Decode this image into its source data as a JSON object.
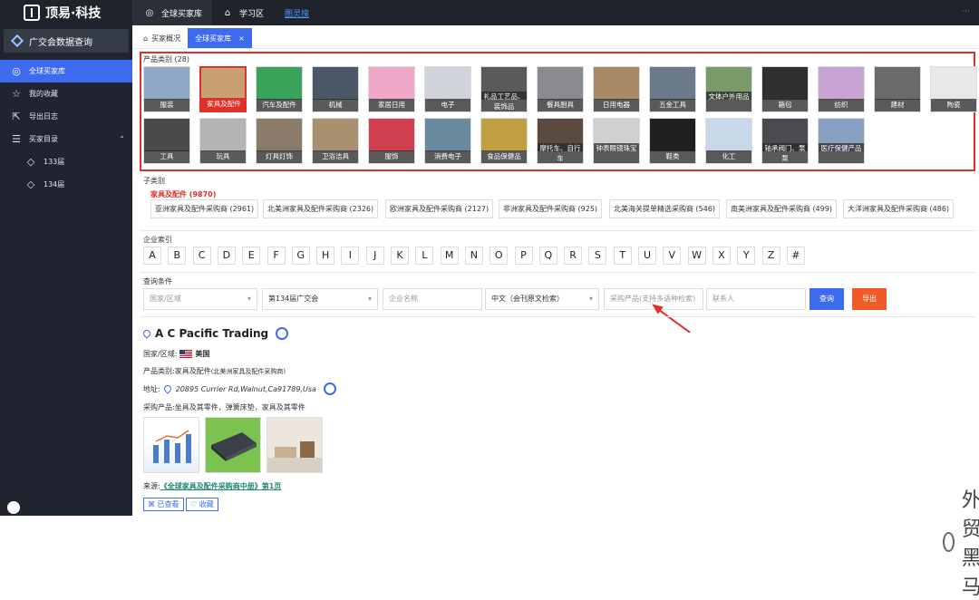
{
  "brand": {
    "name": "顶易·科技"
  },
  "top_tabs": [
    {
      "label": "全球买家库",
      "icon": "globe-icon"
    },
    {
      "label": "学习区",
      "icon": "hat-icon"
    },
    {
      "label": "图灵搜",
      "icon": ""
    }
  ],
  "sidebar": {
    "search_btn": "广交会数据查询",
    "items": [
      {
        "label": "全球买家库",
        "icon": "globe-icon"
      },
      {
        "label": "我的收藏",
        "icon": "star-icon"
      },
      {
        "label": "导出日志",
        "icon": "export-icon"
      },
      {
        "label": "买家目录",
        "icon": "list-icon"
      },
      {
        "label": "133届",
        "icon": "tag-icon"
      },
      {
        "label": "134届",
        "icon": "tag-icon"
      }
    ]
  },
  "page_tabs": [
    {
      "label": "买家概况"
    },
    {
      "label": "全球买家库"
    }
  ],
  "product": {
    "title": "产品类别 (28)",
    "items": [
      "服装",
      "家具及配件",
      "汽车及配件",
      "机械",
      "家居日用",
      "电子",
      "礼品工艺品、装饰品",
      "餐具厨具",
      "日用电器",
      "五金工具",
      "文体户外用品",
      "箱包",
      "纺织",
      "建材",
      "陶瓷",
      "工具",
      "玩具",
      "灯具灯饰",
      "卫浴洁具",
      "服饰",
      "消费电子",
      "食品保健品",
      "摩托车、自行车",
      "钟表眼镜珠宝",
      "鞋类",
      "化工",
      "轴承阀门、泵泵",
      "医疗保健产品"
    ],
    "colors": [
      "#8fa7c4",
      "#c8a074",
      "#3aa35a",
      "#4a5868",
      "#f0a8c8",
      "#d0d4da",
      "#5a5a5a",
      "#8a8a90",
      "#a88a66",
      "#6a7a8a",
      "#7a9a6a",
      "#303030",
      "#c8a4d4",
      "#6a6a6a",
      "#e8e8e8",
      "#4a4a4a",
      "#b4b4b4",
      "#8a7a6a",
      "#a89070",
      "#d04050",
      "#6a8aa0",
      "#c0a040",
      "#5a4a40",
      "#d0d0d0",
      "#202020",
      "#c8d8e8",
      "#4a4a50",
      "#8aa0c0"
    ]
  },
  "subcat": {
    "title": "子类别",
    "selected": "家具及配件 (9870)",
    "chips": [
      "亚洲家具及配件采购商 (2961)",
      "北美洲家具及配件采购商 (2326)",
      "欧洲家具及配件采购商 (2127)",
      "非洲家具及配件采购商 (925)",
      "北美海关提单精选采购商 (546)",
      "南美洲家具及配件采购商 (499)",
      "大洋洲家具及配件采购商 (486)"
    ]
  },
  "index": {
    "title": "企业索引",
    "letters": [
      "A",
      "B",
      "C",
      "D",
      "E",
      "F",
      "G",
      "H",
      "I",
      "J",
      "K",
      "L",
      "M",
      "N",
      "O",
      "P",
      "Q",
      "R",
      "S",
      "T",
      "U",
      "V",
      "W",
      "X",
      "Y",
      "Z",
      "#"
    ]
  },
  "query": {
    "title": "查询条件",
    "region_placeholder": "国家/区域",
    "session_value": "第134届广交会",
    "company_placeholder": "企业名称",
    "lang_value": "中文（会刊原文检索）",
    "product_placeholder": "采购产品(支持多语种检索)",
    "contact_placeholder": "联系人",
    "search_btn": "查询",
    "export_btn": "导出",
    "search_color": "#3d6bf0",
    "export_color": "#f05a28"
  },
  "result": {
    "company": "A C Pacific Trading",
    "country_label": "国家/区域:",
    "country": "美国",
    "category_label": "产品类别:",
    "category": "家具及配件",
    "category_sub": "(北美洲家具及配件采购商)",
    "address_label": "地址:",
    "address": "20895 Currier Rd,Walnut,Ca91789,Usa",
    "purchase_label": "采购产品:",
    "purchase": "坐具及其零件，弹簧床垫，家具及其零件",
    "source_label": "来源:",
    "source_link": "《全球家具及配件采购商中册》第1页",
    "viewed_btn": "已查看",
    "fav_btn": "收藏"
  },
  "watermark": "外贸黑马"
}
